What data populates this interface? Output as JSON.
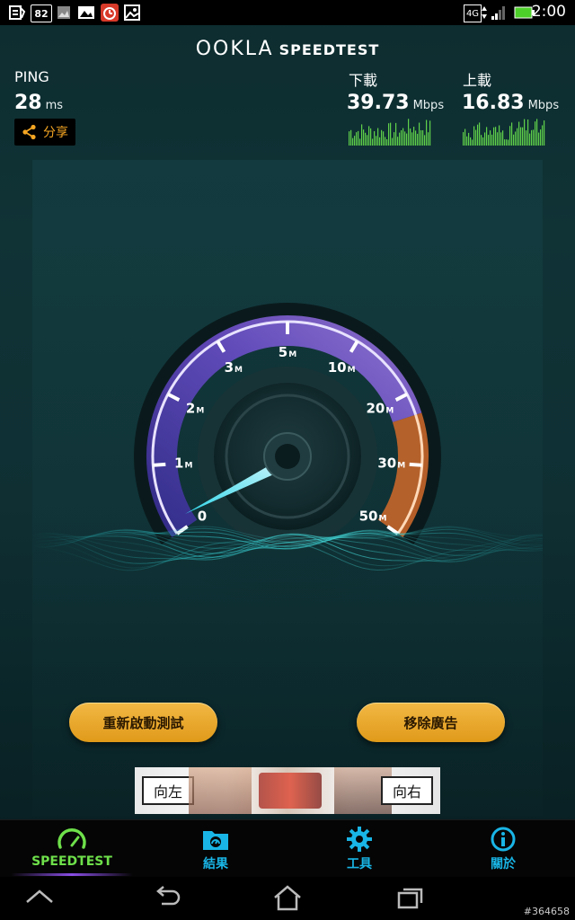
{
  "status_bar": {
    "notification_count": "82",
    "network": "4G",
    "time": "2:00"
  },
  "header": {
    "brand_ookla": "OOKLA",
    "brand_speedtest": "SPEEDTEST"
  },
  "ping": {
    "label": "PING",
    "value": "28",
    "unit": "ms"
  },
  "download": {
    "label": "下載",
    "value": "39.73",
    "unit": "Mbps"
  },
  "upload": {
    "label": "上載",
    "value": "16.83",
    "unit": "Mbps"
  },
  "share": {
    "label": "分享"
  },
  "gauge": {
    "ticks": [
      {
        "label": "0",
        "sub": ""
      },
      {
        "label": "1",
        "sub": "M"
      },
      {
        "label": "2",
        "sub": "M"
      },
      {
        "label": "3",
        "sub": "M"
      },
      {
        "label": "5",
        "sub": "M"
      },
      {
        "label": "10",
        "sub": "M"
      },
      {
        "label": "20",
        "sub": "M"
      },
      {
        "label": "30",
        "sub": "M"
      },
      {
        "label": "50",
        "sub": "M"
      }
    ],
    "needle_value": "0"
  },
  "buttons": {
    "restart": "重新啟動測試",
    "remove_ads": "移除廣告"
  },
  "ad": {
    "left": "向左",
    "right": "向右"
  },
  "tabs": [
    {
      "label": "SPEEDTEST",
      "icon": "gauge-icon",
      "active": true
    },
    {
      "label": "結果",
      "icon": "folder-icon",
      "active": false
    },
    {
      "label": "工具",
      "icon": "gear-icon",
      "active": false
    },
    {
      "label": "關於",
      "icon": "info-icon",
      "active": false
    }
  ],
  "colors": {
    "accent_orange": "#f5a623",
    "accent_cyan": "#19b5e6",
    "active_green": "#6ee04a",
    "gauge_purple": "#7a56d6",
    "background": "#0f2f33"
  },
  "watermark": "#364658"
}
